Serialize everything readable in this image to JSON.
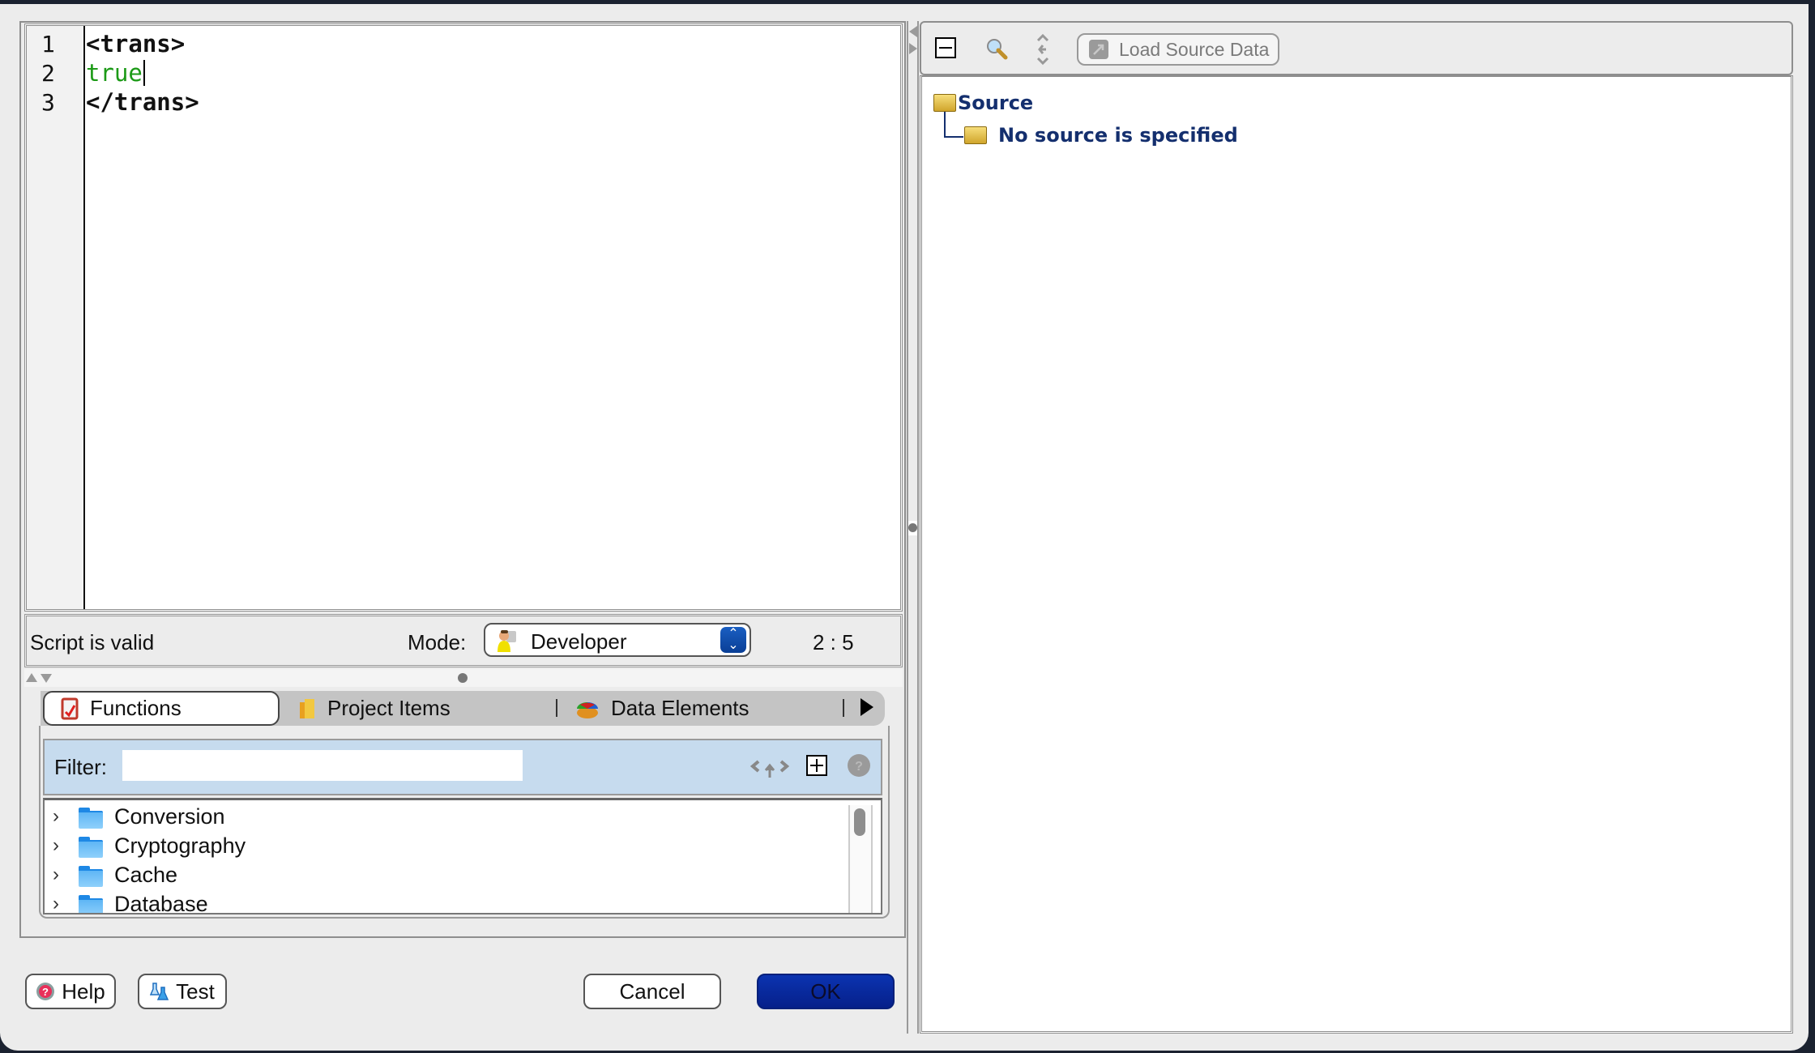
{
  "editor": {
    "lines": [
      {
        "number": "1",
        "text": "<trans>",
        "kind": "tag"
      },
      {
        "number": "2",
        "text": "true",
        "kind": "value"
      },
      {
        "number": "3",
        "text": "</trans>",
        "kind": "tag"
      }
    ]
  },
  "status": {
    "message": "Script is valid",
    "mode_label": "Mode:",
    "mode_value": "Developer",
    "mode_icon": "developer-person-icon",
    "cursor_position": "2 : 5"
  },
  "tabs": [
    {
      "label": "Functions",
      "icon": "functions-icon",
      "active": true
    },
    {
      "label": "Project Items",
      "icon": "project-items-icon",
      "active": false
    },
    {
      "label": "Data Elements",
      "icon": "data-elements-icon",
      "active": false
    }
  ],
  "filter": {
    "label": "Filter:",
    "value": "",
    "placeholder": "",
    "icons": [
      "expand-collapse-icon",
      "add-icon",
      "help-icon"
    ]
  },
  "function_tree": [
    {
      "label": "Conversion"
    },
    {
      "label": "Cryptography"
    },
    {
      "label": "Cache"
    },
    {
      "label": "Database"
    }
  ],
  "buttons": {
    "help": "Help",
    "test": "Test",
    "cancel": "Cancel",
    "ok": "OK"
  },
  "right_toolbar": {
    "load_source_data": "Load Source Data",
    "icons": [
      "collapse-icon",
      "search-icon",
      "expand-arrows-icon"
    ]
  },
  "source_tree": {
    "root": "Source",
    "child": "No source is specified"
  },
  "colors": {
    "ok_button": "#0a2a9a",
    "code_value": "#1c9a17",
    "filter_bg": "#c6dbee",
    "source_text": "#142f6e"
  }
}
